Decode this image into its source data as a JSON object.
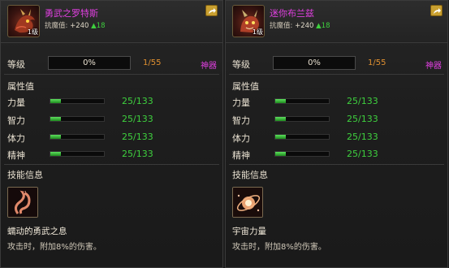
{
  "panels": [
    {
      "name": "勇武之罗特斯",
      "level_badge": "1级",
      "resist_label": "抗魔值:",
      "resist_value": "+240",
      "resist_up_arrow": "▲",
      "resist_up": "18",
      "level_label": "等级",
      "level_percent": "0%",
      "level_fraction": "1/55",
      "artifact_label": "神器",
      "attr_title": "属性值",
      "stats": [
        {
          "name": "力量",
          "value": "25/133",
          "fill": 0.19
        },
        {
          "name": "智力",
          "value": "25/133",
          "fill": 0.19
        },
        {
          "name": "体力",
          "value": "25/133",
          "fill": 0.19
        },
        {
          "name": "精神",
          "value": "25/133",
          "fill": 0.19
        }
      ],
      "skill_title": "技能信息",
      "skill_icon": "serpent-coil-icon",
      "skill_name": "蠕动的勇武之息",
      "skill_desc": "攻击时，附加8%的伤害。"
    },
    {
      "name": "迷你布兰兹",
      "level_badge": "1级",
      "resist_label": "抗魔值:",
      "resist_value": "+240",
      "resist_up_arrow": "▲",
      "resist_up": "18",
      "level_label": "等级",
      "level_percent": "0%",
      "level_fraction": "1/55",
      "artifact_label": "神器",
      "attr_title": "属性值",
      "stats": [
        {
          "name": "力量",
          "value": "25/133",
          "fill": 0.19
        },
        {
          "name": "智力",
          "value": "25/133",
          "fill": 0.19
        },
        {
          "name": "体力",
          "value": "25/133",
          "fill": 0.19
        },
        {
          "name": "精神",
          "value": "25/133",
          "fill": 0.19
        }
      ],
      "skill_title": "技能信息",
      "skill_icon": "cosmic-orb-icon",
      "skill_name": "宇宙力量",
      "skill_desc": "攻击时，附加8%的伤害。"
    }
  ],
  "colors": {
    "name": "#e040e0",
    "artifact": "#e040e0",
    "level_fraction": "#e09030",
    "stat_value": "#3ed03e",
    "bar_fill": "#3ec03e"
  },
  "icons": {
    "share": "share-arrow-icon"
  }
}
